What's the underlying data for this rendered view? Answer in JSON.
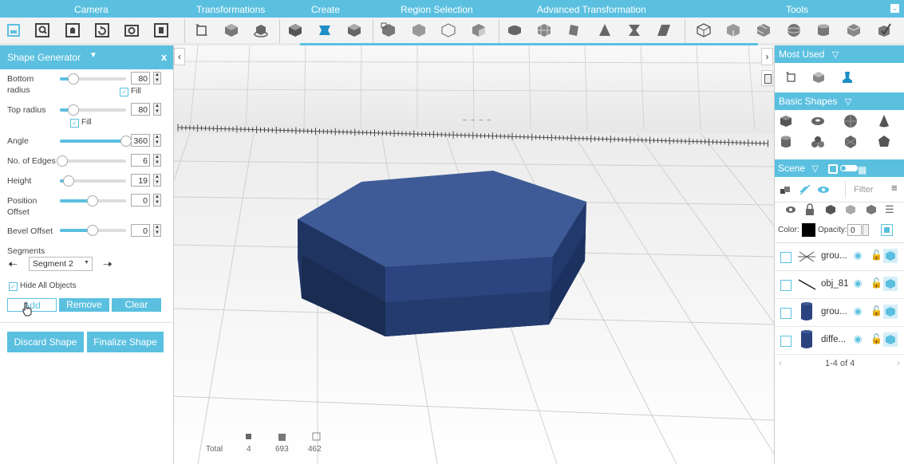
{
  "menubar": {
    "sections": [
      "Camera",
      "Transformations",
      "Create",
      "Region Selection",
      "Advanced Transformation",
      "Tools"
    ]
  },
  "left_panel": {
    "title": "Shape Generator",
    "close": "x",
    "bottom_radius_label": "Bottom\nradius",
    "bottom_radius": "80",
    "top_radius_label": "Top radius",
    "top_radius": "80",
    "fill_label": "Fill",
    "angle_label": "Angle",
    "angle": "360",
    "edges_label": "No. of Edges",
    "edges": "6",
    "height_label": "Height",
    "height": "19",
    "position_offset_label": "Position\nOffset",
    "position_offset": "0",
    "bevel_offset_label": "Bevel Offset",
    "bevel_offset": "0",
    "segments_label": "Segments",
    "segment_selected": "Segment 2",
    "hide_all_label": "Hide All Objects",
    "add_label": "Add",
    "remove_label": "Remove",
    "clear_label": "Clear",
    "discard_label": "Discard Shape",
    "finalize_label": "Finalize Shape"
  },
  "viewport": {
    "total_label": "Total",
    "counts": [
      "4",
      "693",
      "462"
    ]
  },
  "right_panel": {
    "most_used_title": "Most Used",
    "basic_shapes_title": "Basic Shapes",
    "scene_title": "Scene",
    "filter_placeholder": "Filter",
    "color_label": "Color:",
    "opacity_label": "Opacity:",
    "opacity_value": "0",
    "objects": [
      {
        "name": "grou..."
      },
      {
        "name": "obj_81"
      },
      {
        "name": "grou..."
      },
      {
        "name": "diffe..."
      }
    ],
    "pagination": "1-4 of 4"
  },
  "colors": {
    "accent": "#5bc0e0",
    "shape_top": "#3d5a95",
    "shape_side": "#253f73",
    "shape_dark": "#1c2f57"
  }
}
